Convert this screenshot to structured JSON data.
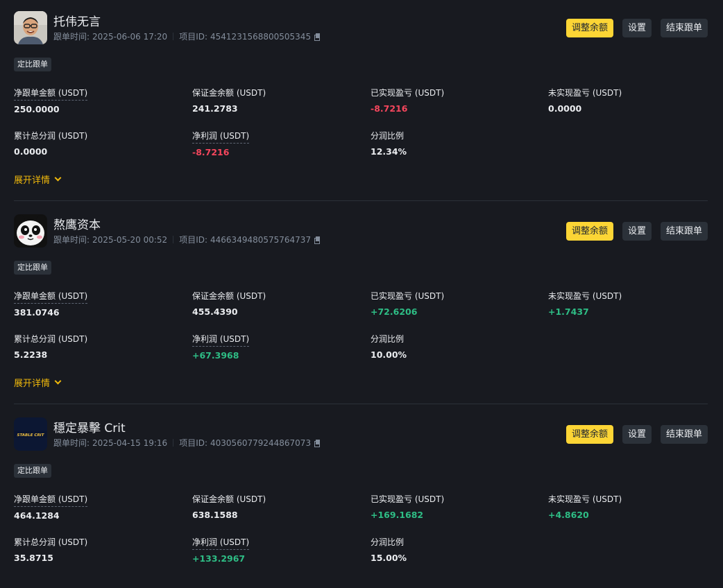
{
  "cards": [
    {
      "name": "托伟无言",
      "follow_time_label": "跟单时间:",
      "follow_time": "2025-06-06 17:20",
      "project_id_label": "项目ID:",
      "project_id": "4541231568800505345",
      "buttons": {
        "adjust": "调整余额",
        "settings": "设置",
        "end": "结束跟单"
      },
      "tag": "定比跟单",
      "stats": {
        "net_amount": {
          "label": "净跟单金额 (USDT)",
          "value": "250.0000"
        },
        "margin_balance": {
          "label": "保证金余额 (USDT)",
          "value": "241.2783"
        },
        "realized_pnl": {
          "label": "已实现盈亏 (USDT)",
          "value": "-8.7216"
        },
        "unrealized_pnl": {
          "label": "未实现盈亏 (USDT)",
          "value": "0.0000"
        },
        "total_share": {
          "label": "累计总分润 (USDT)",
          "value": "0.0000"
        },
        "net_profit": {
          "label": "净利润 (USDT)",
          "value": "-8.7216"
        },
        "share_ratio": {
          "label": "分润比例",
          "value": "12.34%"
        }
      },
      "expand_label": "展开详情"
    },
    {
      "name": "熬鹰资本",
      "follow_time_label": "跟单时间:",
      "follow_time": "2025-05-20 00:52",
      "project_id_label": "项目ID:",
      "project_id": "4466349480575764737",
      "buttons": {
        "adjust": "调整余额",
        "settings": "设置",
        "end": "结束跟单"
      },
      "tag": "定比跟单",
      "stats": {
        "net_amount": {
          "label": "净跟单金额 (USDT)",
          "value": "381.0746"
        },
        "margin_balance": {
          "label": "保证金余额 (USDT)",
          "value": "455.4390"
        },
        "realized_pnl": {
          "label": "已实现盈亏 (USDT)",
          "value": "+72.6206"
        },
        "unrealized_pnl": {
          "label": "未实现盈亏 (USDT)",
          "value": "+1.7437"
        },
        "total_share": {
          "label": "累计总分润 (USDT)",
          "value": "5.2238"
        },
        "net_profit": {
          "label": "净利润 (USDT)",
          "value": "+67.3968"
        },
        "share_ratio": {
          "label": "分润比例",
          "value": "10.00%"
        }
      },
      "expand_label": "展开详情"
    },
    {
      "name": "穩定暴擊 Crit",
      "avatar_text": "STABLE CRIT",
      "follow_time_label": "跟单时间:",
      "follow_time": "2025-04-15 19:16",
      "project_id_label": "项目ID:",
      "project_id": "4030560779244867073",
      "buttons": {
        "adjust": "调整余额",
        "settings": "设置",
        "end": "结束跟单"
      },
      "tag": "定比跟单",
      "stats": {
        "net_amount": {
          "label": "净跟单金额 (USDT)",
          "value": "464.1284"
        },
        "margin_balance": {
          "label": "保证金余额 (USDT)",
          "value": "638.1588"
        },
        "realized_pnl": {
          "label": "已实现盈亏 (USDT)",
          "value": "+169.1682"
        },
        "unrealized_pnl": {
          "label": "未实现盈亏 (USDT)",
          "value": "+4.8620"
        },
        "total_share": {
          "label": "累计总分润 (USDT)",
          "value": "35.8715"
        },
        "net_profit": {
          "label": "净利润 (USDT)",
          "value": "+133.2967"
        },
        "share_ratio": {
          "label": "分润比例",
          "value": "15.00%"
        }
      }
    }
  ],
  "colors": {
    "background": "#181a20",
    "accent": "#fcd535",
    "expand_text": "#f0b90b",
    "positive": "#2ebd85",
    "negative": "#f6465d",
    "muted": "#848e9c",
    "button_bg": "#2b3139"
  }
}
